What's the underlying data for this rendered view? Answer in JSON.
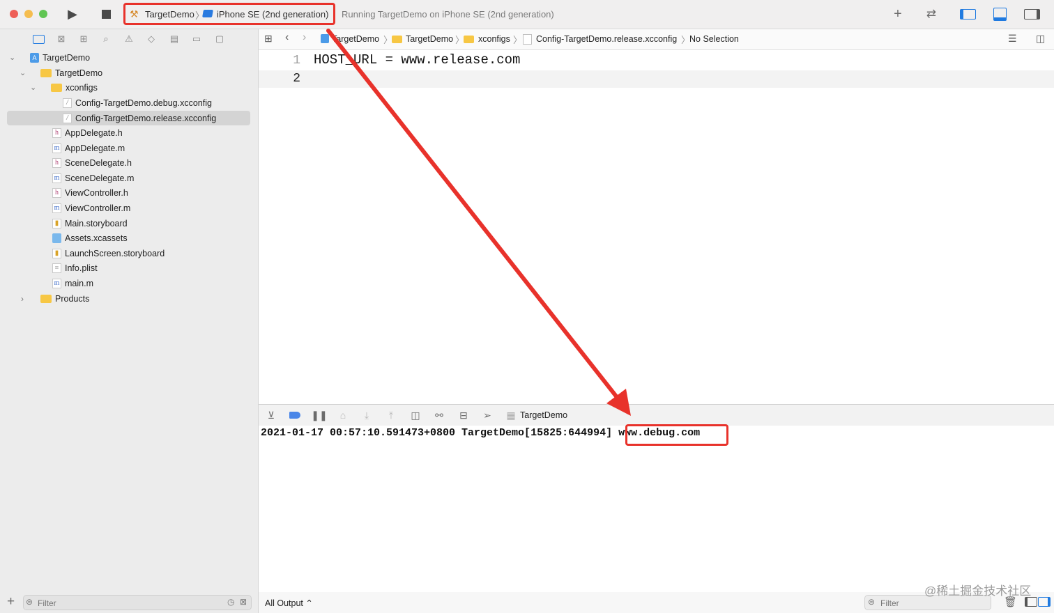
{
  "toolbar": {
    "scheme": "TargetDemo",
    "separator": "〉",
    "device": "iPhone SE (2nd generation)",
    "status": "Running TargetDemo on iPhone SE (2nd generation)"
  },
  "navigator": {
    "items": [
      {
        "label": "TargetDemo"
      },
      {
        "label": "TargetDemo"
      },
      {
        "label": "xconfigs"
      },
      {
        "label": "Config-TargetDemo.debug.xcconfig"
      },
      {
        "label": "Config-TargetDemo.release.xcconfig"
      },
      {
        "label": "AppDelegate.h"
      },
      {
        "label": "AppDelegate.m"
      },
      {
        "label": "SceneDelegate.h"
      },
      {
        "label": "SceneDelegate.m"
      },
      {
        "label": "ViewController.h"
      },
      {
        "label": "ViewController.m"
      },
      {
        "label": "Main.storyboard"
      },
      {
        "label": "Assets.xcassets"
      },
      {
        "label": "LaunchScreen.storyboard"
      },
      {
        "label": "Info.plist"
      },
      {
        "label": "main.m"
      },
      {
        "label": "Products"
      }
    ],
    "filter_placeholder": "Filter"
  },
  "jumpbar": {
    "crumbs": [
      "TargetDemo",
      "TargetDemo",
      "xconfigs",
      "Config-TargetDemo.release.xcconfig",
      "No Selection"
    ]
  },
  "editor": {
    "lines": [
      {
        "num": "1",
        "text": "HOST_URL = www.release.com"
      },
      {
        "num": "2",
        "text": ""
      }
    ]
  },
  "debug": {
    "target": "TargetDemo",
    "console_prefix": "2021-01-17 00:57:10.591473+0800 TargetDemo[15825:644994] ",
    "console_value": "www.debug.com",
    "output_select": "All Output ⌃",
    "filter_placeholder": "Filter"
  },
  "watermark": "@稀土掘金技术社区",
  "colors": {
    "highlight": "#e8322b",
    "accent": "#1f7ae0"
  }
}
